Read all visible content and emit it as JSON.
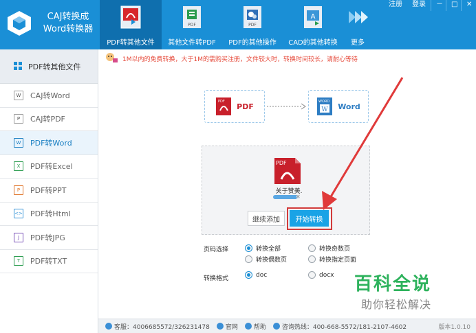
{
  "app": {
    "title_line1": "CAJ转换成",
    "title_line2": "Word转换器"
  },
  "nav": [
    {
      "label": "PDF转其他文件",
      "icon": "pdf-convert-icon",
      "active": true
    },
    {
      "label": "其他文件转PDF",
      "icon": "file-to-pdf-icon",
      "active": false
    },
    {
      "label": "PDF的其他操作",
      "icon": "pdf-settings-icon",
      "active": false
    },
    {
      "label": "CAD的其他转换",
      "icon": "cad-convert-icon",
      "active": false
    },
    {
      "label": "更多",
      "icon": "more-arrows-icon",
      "active": false
    }
  ],
  "window": {
    "register": "注册",
    "login": "登录",
    "minimize": "－",
    "maximize": "□",
    "close": "✕"
  },
  "sidebar": {
    "header": "PDF转其他文件",
    "items": [
      {
        "label": "CAJ转Word",
        "icon": "caj-word-icon"
      },
      {
        "label": "CAJ转PDF",
        "icon": "caj-pdf-icon"
      },
      {
        "label": "PDF转Word",
        "icon": "pdf-word-icon",
        "active": true
      },
      {
        "label": "PDF转Excel",
        "icon": "pdf-excel-icon"
      },
      {
        "label": "PDF转PPT",
        "icon": "pdf-ppt-icon"
      },
      {
        "label": "PDF转Html",
        "icon": "pdf-html-icon"
      },
      {
        "label": "PDF转JPG",
        "icon": "pdf-jpg-icon"
      },
      {
        "label": "PDF转TXT",
        "icon": "pdf-txt-icon"
      }
    ]
  },
  "notice": "1M以内的免费转换，大于1M的需购买注册，文件较大时，转换时间较长，请耐心等待",
  "flow": {
    "from": "PDF",
    "to": "Word",
    "from_badge": "PDF",
    "to_badge": "WORD",
    "to_letter": "W"
  },
  "file": {
    "badge": "PDF",
    "name": "关于赞美.",
    "progress": 0.9,
    "remove": "✕"
  },
  "buttons": {
    "continue": "继续添加",
    "start": "开始转换"
  },
  "options": {
    "page_label": "页码选择",
    "page_opts": [
      "转换全部",
      "转换奇数页",
      "转换偶数页",
      "转换指定页面"
    ],
    "format_label": "转换格式",
    "format_opts": [
      "doc",
      "docx"
    ]
  },
  "footer": {
    "service": "客服：4006685572/326231478",
    "website": "官网",
    "help": "帮助",
    "hotline": "咨询热线：400-668-5572/181-2107-4602",
    "version": "版本1.0.10"
  },
  "watermark": {
    "title": "百科全说",
    "subtitle": "助你轻松解决"
  },
  "colors": {
    "header": "#1a8fd6",
    "active_nav": "#0f6fae",
    "start_button": "#1aa3e6",
    "highlight_frame": "#d23b3b",
    "pdf_red": "#c8202b",
    "word_blue": "#2d7dc3"
  }
}
